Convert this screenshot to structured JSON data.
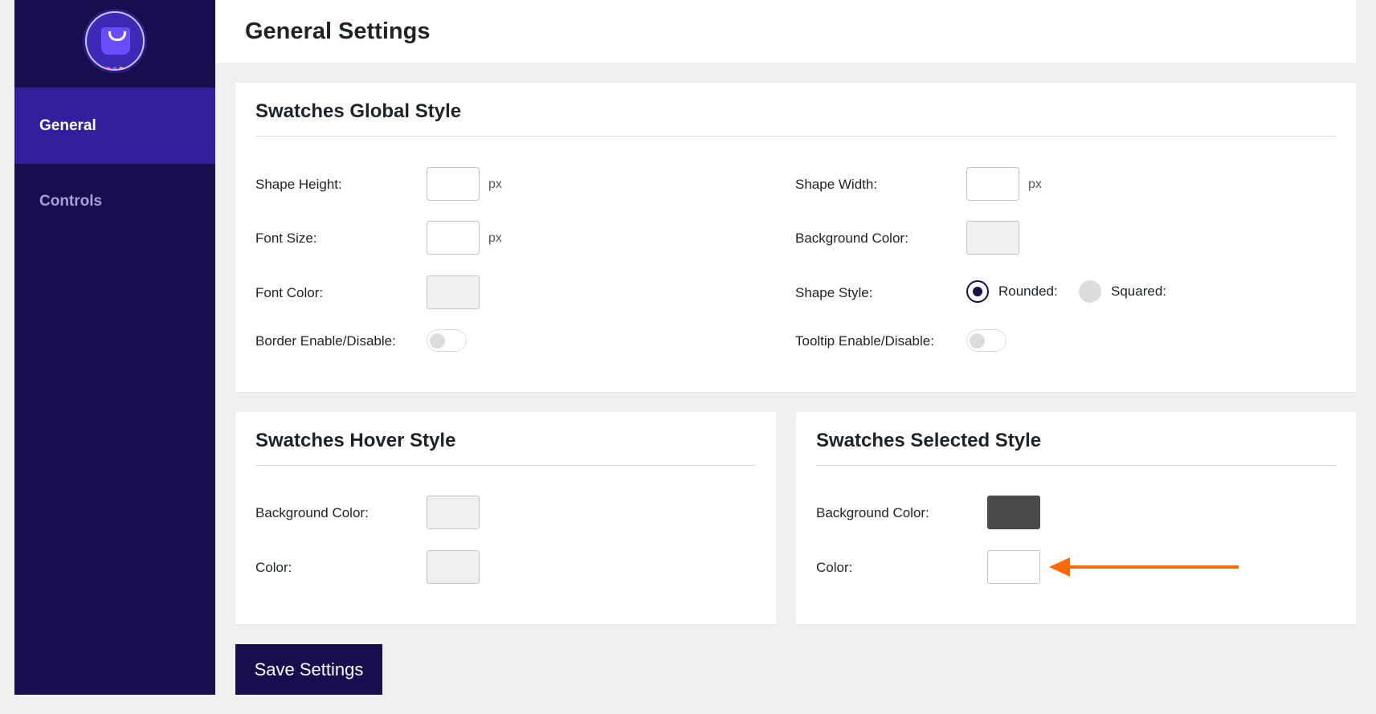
{
  "colors": {
    "sidebar_bg": "#180d4d",
    "sidebar_active_bg": "#351e9e",
    "accent_arrow": "#ff6a00",
    "selected_bg_swatch": "#4a4a4a"
  },
  "logo": {
    "icon": "shopping-bag-icon"
  },
  "sidebar": {
    "items": [
      {
        "label": "General",
        "active": true
      },
      {
        "label": "Controls",
        "active": false
      }
    ]
  },
  "header": {
    "title": "General Settings"
  },
  "global_style": {
    "title": "Swatches Global Style",
    "shape_height_label": "Shape Height:",
    "shape_height_value": "",
    "shape_height_unit": "px",
    "shape_width_label": "Shape Width:",
    "shape_width_value": "",
    "shape_width_unit": "px",
    "font_size_label": "Font Size:",
    "font_size_value": "",
    "font_size_unit": "px",
    "background_color_label": "Background Color:",
    "font_color_label": "Font Color:",
    "shape_style_label": "Shape Style:",
    "shape_style_options": [
      "Rounded:",
      "Squared:"
    ],
    "shape_style_selected": "Rounded:",
    "border_label": "Border Enable/Disable:",
    "border_enabled": false,
    "tooltip_label": "Tooltip Enable/Disable:",
    "tooltip_enabled": false
  },
  "hover_style": {
    "title": "Swatches Hover Style",
    "background_color_label": "Background Color:",
    "color_label": "Color:"
  },
  "selected_style": {
    "title": "Swatches Selected Style",
    "background_color_label": "Background Color:",
    "background_color_value": "#4a4a4a",
    "color_label": "Color:",
    "color_value": "#ffffff"
  },
  "actions": {
    "save_label": "Save Settings"
  }
}
